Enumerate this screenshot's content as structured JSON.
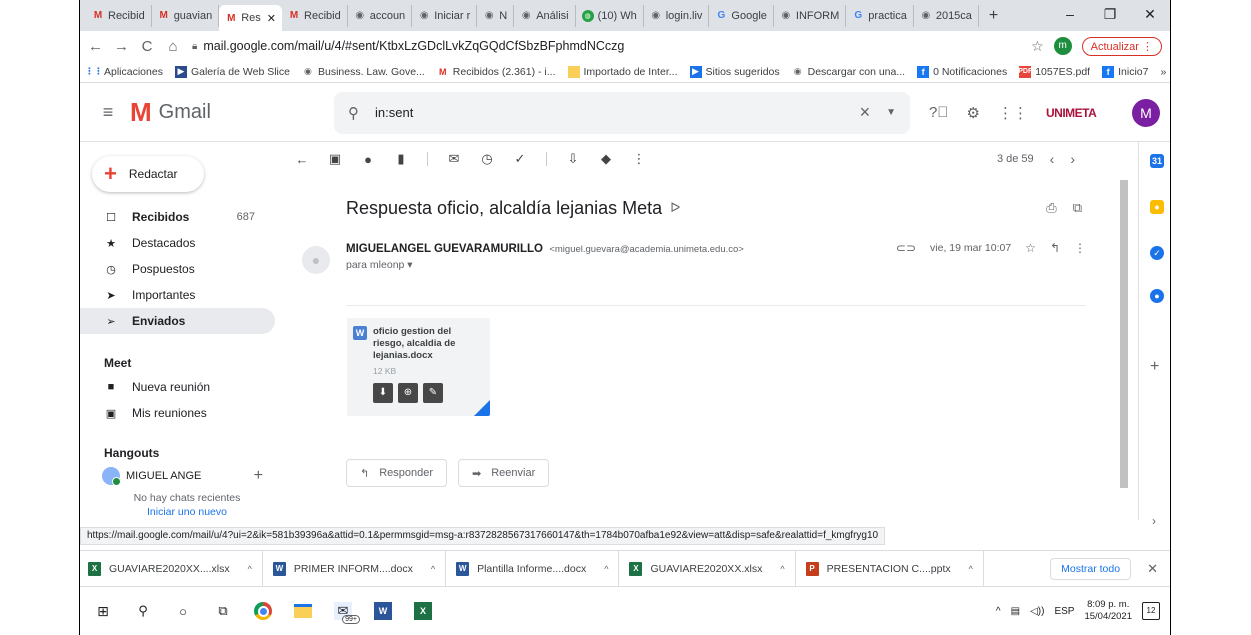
{
  "browser": {
    "tabs": [
      {
        "label": "Recibid",
        "icon": "gmail",
        "active": false
      },
      {
        "label": "guavian",
        "icon": "gmail",
        "active": false
      },
      {
        "label": "Res",
        "icon": "gmail",
        "active": true
      },
      {
        "label": "Recibid",
        "icon": "gmail",
        "active": false
      },
      {
        "label": "accoun",
        "icon": "globe",
        "active": false
      },
      {
        "label": "Iniciar r",
        "icon": "globe",
        "active": false
      },
      {
        "label": "N",
        "icon": "globe",
        "active": false
      },
      {
        "label": "Análisi",
        "icon": "globe",
        "active": false
      },
      {
        "label": "(10) Wh",
        "icon": "green",
        "active": false
      },
      {
        "label": "login.liv",
        "icon": "globe",
        "active": false
      },
      {
        "label": "Google",
        "icon": "g",
        "active": false
      },
      {
        "label": "INFORM",
        "icon": "globe",
        "active": false
      },
      {
        "label": "practica",
        "icon": "g",
        "active": false
      },
      {
        "label": "2015ca",
        "icon": "globe",
        "active": false
      }
    ],
    "new_tab": "+",
    "window_controls": {
      "minimize": "–",
      "restore": "❐",
      "close": "✕"
    },
    "url": "mail.google.com/mail/u/4/#sent/KtbxLzGDclLvkZqGQdCfSbzBFphmdNCczg",
    "profile_letter": "m",
    "update_label": "Actualizar",
    "bookmarks": [
      {
        "label": "Aplicaciones",
        "icon": "apps"
      },
      {
        "label": "Galería de Web Slice",
        "icon": "web"
      },
      {
        "label": "Business. Law. Gove...",
        "icon": "globe"
      },
      {
        "label": "Recibidos (2.361) - i...",
        "icon": "gm"
      },
      {
        "label": "Importado de Inter...",
        "icon": "folder"
      },
      {
        "label": "Sitios sugeridos",
        "icon": "play"
      },
      {
        "label": "Descargar con una...",
        "icon": "globe"
      },
      {
        "label": "0 Notificaciones",
        "icon": "fb"
      },
      {
        "label": "1057ES.pdf",
        "icon": "pdf"
      },
      {
        "label": "Inicio7",
        "icon": "fb"
      }
    ],
    "bookmarks_more": "»",
    "status_url": "https://mail.google.com/mail/u/4?ui=2&ik=581b39396a&attid=0.1&permmsgid=msg-a:r8372828567317660147&th=1784b070afba1e92&view=att&disp=safe&realattid=f_kmgfryg10"
  },
  "gmail": {
    "logo_text": "Gmail",
    "search_value": "in:sent",
    "org_logo_text": "UNIMETA",
    "account_letter": "M",
    "compose_label": "Redactar",
    "nav": [
      {
        "label": "Recibidos",
        "count": "687",
        "bold": true,
        "selected": false,
        "icon": "inbox-icon",
        "glyph": "☐"
      },
      {
        "label": "Destacados",
        "count": "",
        "bold": false,
        "selected": false,
        "icon": "star-icon",
        "glyph": "★"
      },
      {
        "label": "Pospuestos",
        "count": "",
        "bold": false,
        "selected": false,
        "icon": "clock-icon",
        "glyph": "◷"
      },
      {
        "label": "Importantes",
        "count": "",
        "bold": false,
        "selected": false,
        "icon": "important-icon",
        "glyph": "➤"
      },
      {
        "label": "Enviados",
        "count": "",
        "bold": true,
        "selected": true,
        "icon": "send-icon",
        "glyph": "➢"
      }
    ],
    "meet": {
      "title": "Meet",
      "items": [
        {
          "label": "Nueva reunión",
          "icon": "video-icon",
          "glyph": "■"
        },
        {
          "label": "Mis reuniones",
          "icon": "calendar-icon",
          "glyph": "▣"
        }
      ]
    },
    "hangouts": {
      "title": "Hangouts",
      "user": "MIGUEL ANGE",
      "no_chats": "No hay chats recientes",
      "start_new": "Iniciar uno nuevo"
    },
    "pager": "3 de 59",
    "message": {
      "subject": "Respuesta oficio, alcaldía lejanias Meta",
      "sender_name": "MIGUELANGEL GUEVARAMURILLO",
      "sender_email": "<miguel.guevara@academia.unimeta.edu.co>",
      "to": "para mleonp",
      "date": "vie, 19 mar 10:07",
      "attachment": {
        "name": "oficio gestion del riesgo, alcaldia de lejanias.docx",
        "size": "12 KB"
      },
      "reply_label": "Responder",
      "forward_label": "Reenviar"
    }
  },
  "downloads": {
    "items": [
      {
        "name": "GUAVIARE2020XX....xlsx",
        "type": "x"
      },
      {
        "name": "PRIMER INFORM....docx",
        "type": "w"
      },
      {
        "name": "Plantilla Informe....docx",
        "type": "w"
      },
      {
        "name": "GUAVIARE2020XX.xlsx",
        "type": "x"
      },
      {
        "name": "PRESENTACION C....pptx",
        "type": "p"
      }
    ],
    "show_all": "Mostrar todo"
  },
  "taskbar": {
    "mail_badge": "99+",
    "language": "ESP",
    "time": "8:09 p. m.",
    "date": "15/04/2021",
    "notifications": "12"
  }
}
